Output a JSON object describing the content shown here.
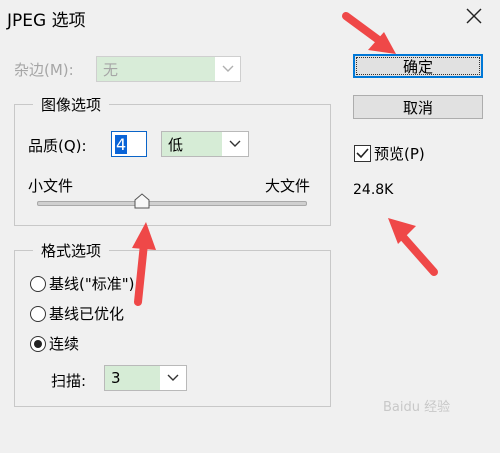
{
  "window": {
    "title": "JPEG 选项"
  },
  "matte": {
    "label": "杂边(M):",
    "value": "无"
  },
  "image_options": {
    "legend": "图像选项",
    "quality_label": "品质(Q):",
    "quality_value": "4",
    "quality_level": "低",
    "slider_min_label": "小文件",
    "slider_max_label": "大文件",
    "slider_position": 0.39
  },
  "format_options": {
    "legend": "格式选项",
    "radios": [
      {
        "label": "基线(\"标准\")",
        "checked": false
      },
      {
        "label": "基线已优化",
        "checked": false
      },
      {
        "label": "连续",
        "checked": true
      }
    ],
    "scan_label": "扫描:",
    "scan_value": "3"
  },
  "buttons": {
    "ok": "确定",
    "cancel": "取消"
  },
  "preview": {
    "label": "预览(P)",
    "checked": true
  },
  "file_size": "24.8K",
  "watermark": "Baidu 经验",
  "colors": {
    "arrow": "#ef4848",
    "field_bg": "#d6ecd6",
    "accent": "#0078d7"
  }
}
